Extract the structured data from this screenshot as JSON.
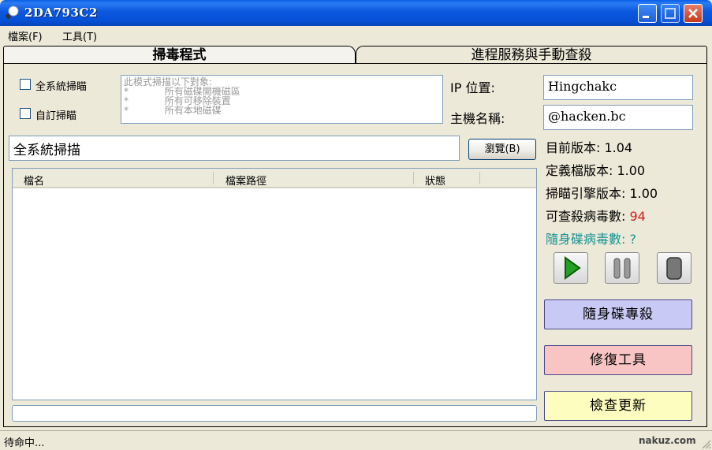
{
  "window": {
    "title": "2DA793C2"
  },
  "menu": {
    "items": [
      "檔案(F)",
      "工具(T)"
    ]
  },
  "tabs": [
    "掃毒程式",
    "進程服務與手動查殺"
  ],
  "scan_options": {
    "full_scan_label": "全系統掃瞄",
    "custom_scan_label": "自訂掃瞄",
    "description_lines": [
      "此模式掃描以下對象:",
      "*            所有磁碟開機磁區",
      "*            所有可移除裝置",
      "*            所有本地磁碟"
    ]
  },
  "path_field": {
    "value": "全系統掃描"
  },
  "browse_button": {
    "label": "瀏覽(B)"
  },
  "file_list": {
    "columns": [
      "檔名",
      "檔案路徑",
      "狀態"
    ]
  },
  "host_info": {
    "ip_label": "IP 位置:",
    "ip_value": "Hingchakc",
    "hostname_label": "主機名稱:",
    "hostname_value": "@hacken.bc"
  },
  "versions": {
    "current_version": "目前版本: 1.04",
    "definition_version": "定義檔版本: 1.00",
    "engine_version": "掃瞄引擎版本: 1.00",
    "virus_count_label": "可查殺病毒數:",
    "virus_count_value": "94",
    "usb_virus_label": "隨身碟病毒數:",
    "usb_virus_value": "?"
  },
  "controls": {
    "play": "play-icon",
    "pause": "pause-icon",
    "stop": "stop-icon"
  },
  "actions": {
    "usb_kill": "隨身碟專殺",
    "repair_tools": "修復工具",
    "check_update": "檢查更新"
  },
  "status": {
    "text": "待命中...",
    "watermark": "nakuz.com"
  },
  "colors": {
    "usb_kill_bg": "#c9c9f5",
    "repair_bg": "#f9c4c4",
    "update_bg": "#fdfdc0",
    "virus_count": "#d12020",
    "usb_virus_text": "#159393"
  }
}
